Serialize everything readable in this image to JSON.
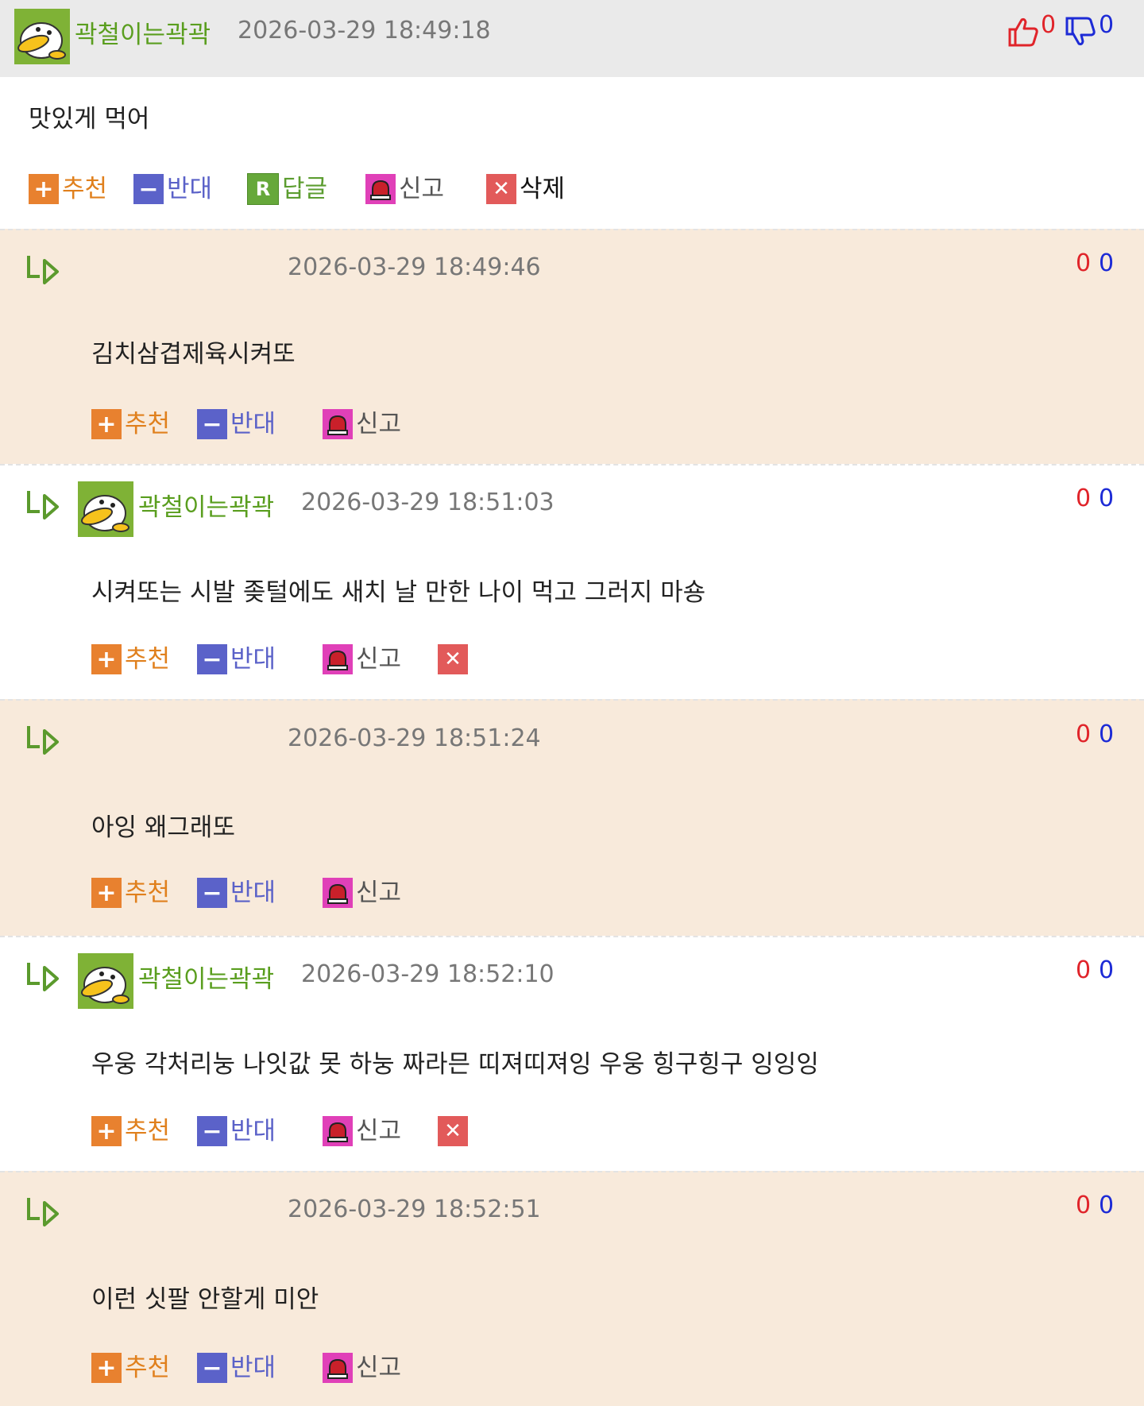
{
  "comment": {
    "author": "곽철이는곽곽",
    "timestamp": "2026-03-29 18:49:18",
    "up_count": "0",
    "down_count": "0",
    "text": "맛있게 먹어",
    "actions": {
      "up": "추천",
      "down": "반대",
      "reply": "답글",
      "report": "신고",
      "delete": "삭제"
    }
  },
  "replies": [
    {
      "author": "",
      "timestamp": "2026-03-29 18:49:46",
      "up_count": "0",
      "down_count": "0",
      "text": "김치삼겹제육시켜또",
      "actions": {
        "up": "추천",
        "down": "반대",
        "report": "신고"
      }
    },
    {
      "author": "곽철이는곽곽",
      "timestamp": "2026-03-29 18:51:03",
      "up_count": "0",
      "down_count": "0",
      "text": "시켜또는 시발 좆털에도 새치 날 만한 나이 먹고 그러지 마숑",
      "actions": {
        "up": "추천",
        "down": "반대",
        "report": "신고"
      }
    },
    {
      "author": "",
      "timestamp": "2026-03-29 18:51:24",
      "up_count": "0",
      "down_count": "0",
      "text": "아잉 왜그래또",
      "actions": {
        "up": "추천",
        "down": "반대",
        "report": "신고"
      }
    },
    {
      "author": "곽철이는곽곽",
      "timestamp": "2026-03-29 18:52:10",
      "up_count": "0",
      "down_count": "0",
      "text": "우웅 각처리눙 나잇값 못 하눙 짜라믄 띠져띠져잉 우웅 힝구힝구 잉잉잉",
      "actions": {
        "up": "추천",
        "down": "반대",
        "report": "신고"
      }
    },
    {
      "author": "",
      "timestamp": "2026-03-29 18:52:51",
      "up_count": "0",
      "down_count": "0",
      "text": "이런 싯팔 안할게 미안",
      "actions": {
        "up": "추천",
        "down": "반대",
        "report": "신고"
      }
    }
  ],
  "colors": {
    "header_bg": "#eaeaea",
    "reply_beige": "#f8eadb",
    "nick_green": "#5a9e1f",
    "up_red": "#e0242a",
    "down_blue": "#1d2bd6"
  }
}
